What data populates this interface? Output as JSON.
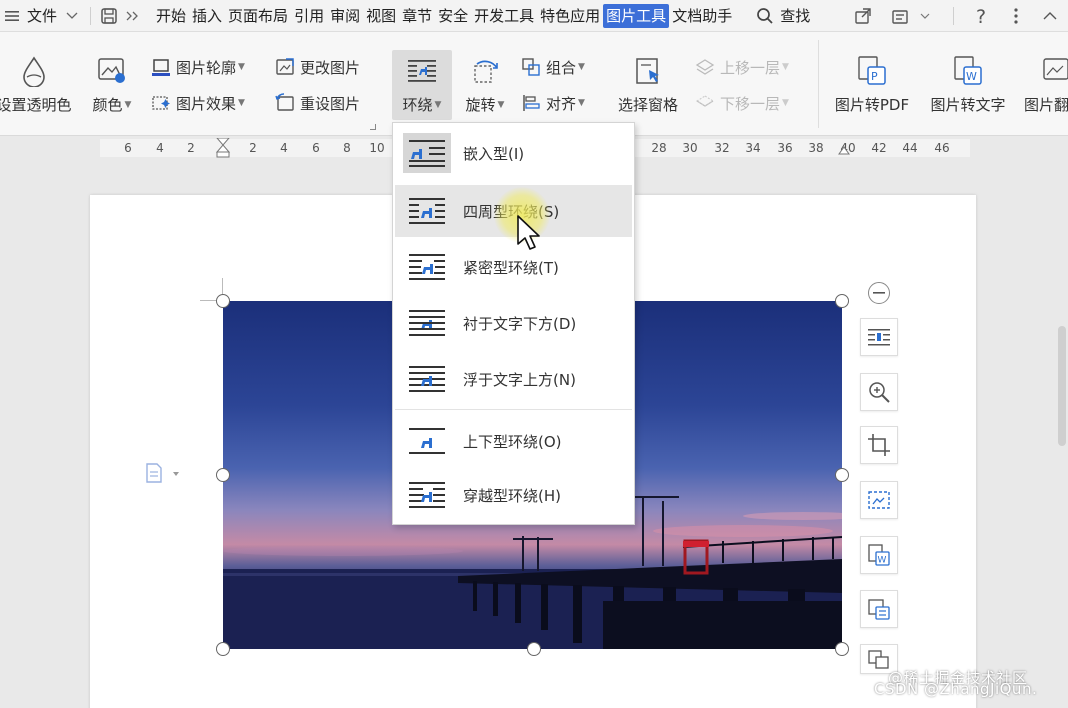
{
  "menubar": {
    "menu_label": "文件",
    "tabs": [
      "开始",
      "插入",
      "页面布局",
      "引用",
      "审阅",
      "视图",
      "章节",
      "安全",
      "开发工具",
      "特色应用",
      "图片工具",
      "文档助手"
    ],
    "active_tab": "图片工具",
    "search_label": "查找"
  },
  "ribbon": {
    "transparent_color": "设置透明色",
    "color": "颜色",
    "outline": "图片轮廓",
    "effects": "图片效果",
    "change_picture": "更改图片",
    "reset_picture": "重设图片",
    "wrap": "环绕",
    "rotate": "旋转",
    "group": "组合",
    "align": "对齐",
    "selection_pane": "选择窗格",
    "bring_forward": "上移一层",
    "send_backward": "下移一层",
    "to_pdf": "图片转PDF",
    "to_text": "图片转文字",
    "more_cut": "图片翻"
  },
  "ruler": {
    "left_numbers": [
      "6",
      "4",
      "2",
      "2",
      "4",
      "6",
      "8",
      "10"
    ],
    "right_numbers": [
      "28",
      "30",
      "32",
      "34",
      "36",
      "38",
      "40",
      "42",
      "44",
      "46"
    ]
  },
  "wrap_menu": {
    "items": [
      {
        "label": "嵌入型(I)",
        "icon": "inline-wrap-icon"
      },
      {
        "label": "四周型环绕(S)",
        "icon": "square-wrap-icon"
      },
      {
        "label": "紧密型环绕(T)",
        "icon": "tight-wrap-icon"
      },
      {
        "label": "衬于文字下方(D)",
        "icon": "behind-text-icon"
      },
      {
        "label": "浮于文字上方(N)",
        "icon": "in-front-of-text-icon"
      },
      {
        "label": "上下型环绕(O)",
        "icon": "top-bottom-wrap-icon"
      },
      {
        "label": "穿越型环绕(H)",
        "icon": "through-wrap-icon"
      }
    ],
    "hovered": "四周型环绕(S)"
  },
  "watermark": {
    "line1": "@稀土掘金技术社区",
    "line2": "CSDN @ZhangJiQun."
  },
  "colors": {
    "accent": "#3c6fd8",
    "icon_blue": "#2b6fd0"
  }
}
